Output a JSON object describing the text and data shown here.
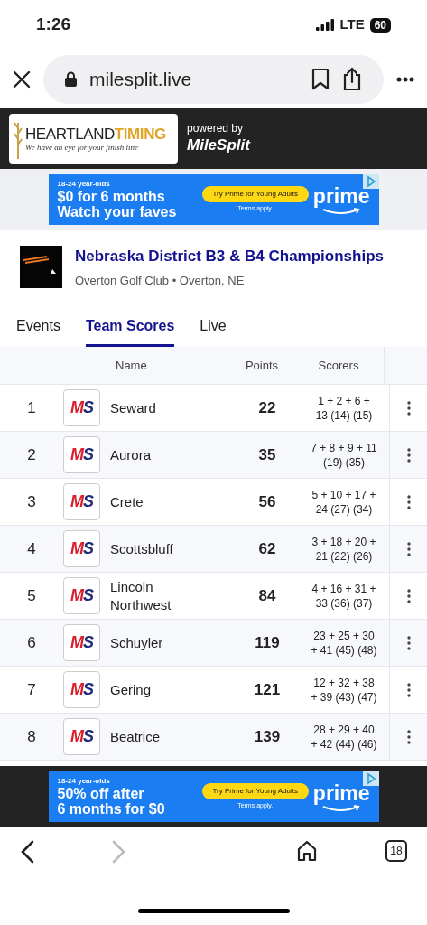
{
  "status_bar": {
    "time": "1:26",
    "network": "LTE",
    "battery": "60"
  },
  "browser": {
    "url": "milesplit.live",
    "tab_count": "18"
  },
  "banner": {
    "logo_main": "HEARTLAND",
    "logo_accent": "TIMING",
    "logo_tagline": "We have an eye for your finish line",
    "powered_by": "powered by",
    "brand": "MileSplit"
  },
  "ads": [
    {
      "eyebrow": "18-24 year-olds",
      "headline": [
        "$0 for 6 months",
        "Watch your faves"
      ],
      "cta": "Try Prime for Young Adults",
      "terms": "Terms apply.",
      "brand": "prime"
    },
    {
      "eyebrow": "18-24 year-olds",
      "headline": [
        "50% off after",
        "6 months for $0"
      ],
      "cta": "Try Prime for Young Adults",
      "terms": "Terms apply.",
      "brand": "prime"
    }
  ],
  "meet": {
    "title": "Nebraska District B3 & B4 Championships",
    "location": "Overton Golf Club • Overton, NE"
  },
  "tabs": [
    {
      "label": "Events",
      "selected": false
    },
    {
      "label": "Team Scores",
      "selected": true
    },
    {
      "label": "Live",
      "selected": false
    }
  ],
  "table": {
    "columns": [
      "Name",
      "Points",
      "Scorers"
    ],
    "rows": [
      {
        "rank": "1",
        "logo": "MS",
        "name": "Seward",
        "points": "22",
        "scorers": "1 + 2 + 6 + 13 (14) (15)"
      },
      {
        "rank": "2",
        "logo": "MS",
        "name": "Aurora",
        "points": "35",
        "scorers": "7 + 8 + 9 + 11 (19) (35)"
      },
      {
        "rank": "3",
        "logo": "MS",
        "name": "Crete",
        "points": "56",
        "scorers": "5 + 10 + 17 + 24 (27) (34)"
      },
      {
        "rank": "4",
        "logo": "MS",
        "name": "Scottsbluff",
        "points": "62",
        "scorers": "3 + 18 + 20 + 21 (22) (26)"
      },
      {
        "rank": "5",
        "logo": "MS",
        "name": "Lincoln Northwest",
        "points": "84",
        "scorers": "4 + 16 + 31 + 33 (36) (37)"
      },
      {
        "rank": "6",
        "logo": "MS",
        "name": "Schuyler",
        "points": "119",
        "scorers": "23 + 25 + 30 + 41 (45) (48)"
      },
      {
        "rank": "7",
        "logo": "MS",
        "name": "Gering",
        "points": "121",
        "scorers": "12 + 32 + 38 + 39 (43) (47)"
      },
      {
        "rank": "8",
        "logo": "MS",
        "name": "Beatrice",
        "points": "139",
        "scorers": "28 + 29 + 40 + 42 (44) (46)"
      }
    ]
  }
}
